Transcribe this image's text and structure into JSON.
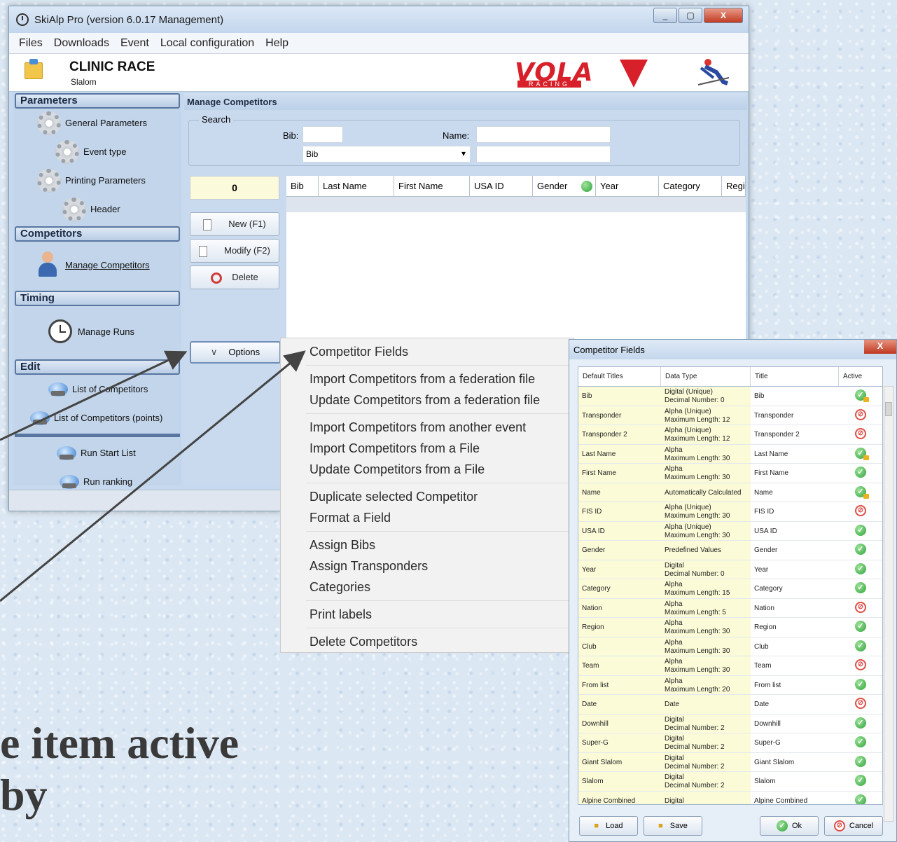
{
  "window": {
    "title": "SkiAlp Pro (version 6.0.17 Management)",
    "close": "X"
  },
  "menu": [
    "Files",
    "Downloads",
    "Event",
    "Local configuration",
    "Help"
  ],
  "header": {
    "race_name": "CLINIC RACE",
    "discipline": "Slalom",
    "brand": "VOLA",
    "brand_sub": "RACING"
  },
  "sidebar": {
    "parameters": {
      "title": "Parameters",
      "items": [
        "General Parameters",
        "Event type",
        "Printing Parameters",
        "Header"
      ]
    },
    "competitors": {
      "title": "Competitors",
      "items": [
        "Manage Competitors"
      ]
    },
    "timing": {
      "title": "Timing",
      "items": [
        "Manage Runs"
      ]
    },
    "edit": {
      "title": "Edit",
      "items": [
        "List of Competitors",
        "List of Competitors (points)",
        "Run Start List",
        "Run ranking"
      ]
    }
  },
  "content": {
    "title": "Manage Competitors",
    "search": {
      "legend": "Search",
      "bib_label": "Bib:",
      "name_label": "Name:",
      "sort_value": "Bib"
    },
    "count": "0",
    "buttons": {
      "new": "New (F1)",
      "modify": "Modify (F2)",
      "delete": "Delete",
      "options": "Options"
    },
    "columns": [
      "Bib",
      "Last Name",
      "First Name",
      "USA ID",
      "Gender",
      "Year",
      "Category",
      "Regi"
    ]
  },
  "context_menu": [
    "Competitor Fields",
    "Import Competitors from a federation file",
    "Update Competitors from a federation file",
    "Import Competitors from another event",
    "Import Competitors from a File",
    "Update Competitors from a File",
    "Duplicate selected Competitor",
    "Format a Field",
    "Assign Bibs",
    "Assign Transponders",
    "Categories",
    "Print labels",
    "Delete Competitors"
  ],
  "dialog": {
    "title": "Competitor Fields",
    "close": "X",
    "columns": [
      "Default Titles",
      "Data Type",
      "Title",
      "Active"
    ],
    "rows": [
      {
        "default": "Bib",
        "type": [
          "Digital (Unique)",
          "Decimal Number: 0"
        ],
        "title": "Bib",
        "active": "ok-lock"
      },
      {
        "default": "Transponder",
        "type": [
          "Alpha (Unique)",
          "Maximum Length: 12"
        ],
        "title": "Transponder",
        "active": "no"
      },
      {
        "default": "Transponder 2",
        "type": [
          "Alpha (Unique)",
          "Maximum Length: 12"
        ],
        "title": "Transponder 2",
        "active": "no"
      },
      {
        "default": "Last Name",
        "type": [
          "Alpha",
          "Maximum Length: 30"
        ],
        "title": "Last Name",
        "active": "ok-lock"
      },
      {
        "default": "First Name",
        "type": [
          "Alpha",
          "Maximum Length: 30"
        ],
        "title": "First Name",
        "active": "ok"
      },
      {
        "default": "Name",
        "type": [
          "Automatically Calculated"
        ],
        "title": "Name",
        "active": "ok-lock"
      },
      {
        "default": "FIS ID",
        "type": [
          "Alpha (Unique)",
          "Maximum Length: 30"
        ],
        "title": "FIS ID",
        "active": "no"
      },
      {
        "default": "USA ID",
        "type": [
          "Alpha (Unique)",
          "Maximum Length: 30"
        ],
        "title": "USA ID",
        "active": "ok"
      },
      {
        "default": "Gender",
        "type": [
          "Predefined Values"
        ],
        "title": "Gender",
        "active": "ok"
      },
      {
        "default": "Year",
        "type": [
          "Digital",
          "Decimal Number: 0"
        ],
        "title": "Year",
        "active": "ok"
      },
      {
        "default": "Category",
        "type": [
          "Alpha",
          "Maximum Length: 15"
        ],
        "title": "Category",
        "active": "ok"
      },
      {
        "default": "Nation",
        "type": [
          "Alpha",
          "Maximum Length: 5"
        ],
        "title": "Nation",
        "active": "no"
      },
      {
        "default": "Region",
        "type": [
          "Alpha",
          "Maximum Length: 30"
        ],
        "title": "Region",
        "active": "ok"
      },
      {
        "default": "Club",
        "type": [
          "Alpha",
          "Maximum Length: 30"
        ],
        "title": "Club",
        "active": "ok"
      },
      {
        "default": "Team",
        "type": [
          "Alpha",
          "Maximum Length: 30"
        ],
        "title": "Team",
        "active": "no"
      },
      {
        "default": "From list",
        "type": [
          "Alpha",
          "Maximum Length: 20"
        ],
        "title": "From list",
        "active": "ok"
      },
      {
        "default": "Date",
        "type": [
          "Date"
        ],
        "title": "Date",
        "active": "no"
      },
      {
        "default": "Downhill",
        "type": [
          "Digital",
          "Decimal Number: 2"
        ],
        "title": "Downhill",
        "active": "ok"
      },
      {
        "default": "Super-G",
        "type": [
          "Digital",
          "Decimal Number: 2"
        ],
        "title": "Super-G",
        "active": "ok"
      },
      {
        "default": "Giant Slalom",
        "type": [
          "Digital",
          "Decimal Number: 2"
        ],
        "title": "Giant Slalom",
        "active": "ok"
      },
      {
        "default": "Slalom",
        "type": [
          "Digital",
          "Decimal Number: 2"
        ],
        "title": "Slalom",
        "active": "ok"
      },
      {
        "default": "Alpine Combined",
        "type": [
          "Digital"
        ],
        "title": "Alpine Combined",
        "active": "ok"
      }
    ],
    "buttons": {
      "load": "Load",
      "save": "Save",
      "ok": "Ok",
      "cancel": "Cancel"
    }
  },
  "slide_text": {
    "line1": "e item active",
    "line2": "by"
  }
}
